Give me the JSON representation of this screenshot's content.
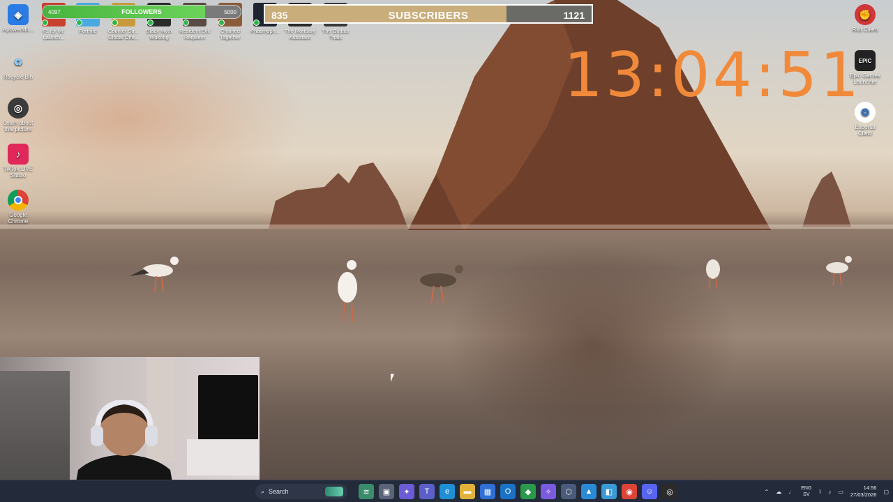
{
  "desktop": {
    "left_icons": [
      {
        "label": "ApowerMir...",
        "icon": "apowermirror-icon",
        "color": "#2a7be4"
      },
      {
        "label": "Recycle Bin",
        "icon": "recycle-bin-icon",
        "color": "#4aa3e0"
      },
      {
        "label": "Learn about this picture",
        "icon": "camera-icon",
        "color": "#3b3b3b"
      },
      {
        "label": "TikTok LIVE Studio",
        "icon": "tiktok-icon",
        "color": "#e0285a"
      },
      {
        "label": "Google Chrome",
        "icon": "chrome-icon",
        "color": "#db4437"
      }
    ],
    "right_icons": [
      {
        "label": "Riot Client",
        "icon": "riot-client-icon",
        "color": "#d13639"
      },
      {
        "label": "Epic Games Launcher",
        "icon": "epic-games-icon",
        "color": "#222222"
      },
      {
        "label": "Esportal Client",
        "icon": "esportal-icon",
        "color": "#3f7cc4"
      }
    ],
    "game_icons": [
      {
        "label": "F1 for Mr. Launch...",
        "icon": "f1-icon",
        "color": "#c8412f"
      },
      {
        "label": "Fortnite",
        "icon": "fortnite-icon",
        "color": "#4aa9de"
      },
      {
        "label": "Counter Str... Global Offe...",
        "icon": "counter-strike-icon",
        "color": "#c99a3c"
      },
      {
        "label": "Black Myth Wukong",
        "icon": "black-myth-icon",
        "color": "#2b2b2b"
      },
      {
        "label": "Resident Evil Requiem",
        "icon": "resident-evil-icon",
        "color": "#5a4a44"
      },
      {
        "label": "Chained Together",
        "icon": "chained-together-icon",
        "color": "#8b5c3a"
      },
      {
        "label": "Phasmoph...",
        "icon": "phasmophobia-icon",
        "color": "#1e2430"
      },
      {
        "label": "The Mortuary Assistant",
        "icon": "mortuary-icon",
        "color": "#2a2a2a"
      },
      {
        "label": "The Outlast Trials",
        "icon": "outlast-icon",
        "color": "#3a3a3a"
      }
    ]
  },
  "followers_goal": {
    "label": "FOLLOWERS",
    "current": "4097",
    "goal": "5000",
    "progress": 0.82
  },
  "subscribers_goal": {
    "current": "835",
    "label": "SUBSCRIBERS",
    "goal": "1121",
    "progress": 0.74
  },
  "clock": {
    "time": "13:04:51",
    "color": "#f08a3a"
  },
  "taskbar": {
    "search_placeholder": "Search",
    "apps": [
      {
        "icon": "widgets-icon",
        "color": "#3a8c6a",
        "glyph": "≋"
      },
      {
        "icon": "task-view-icon",
        "color": "#5a6478",
        "glyph": "▣"
      },
      {
        "icon": "copilot-icon",
        "color": "#6b5bd6",
        "glyph": "✦"
      },
      {
        "icon": "teams-icon",
        "color": "#5b5fc7",
        "glyph": "T"
      },
      {
        "icon": "edge-icon",
        "color": "#1f8fd6",
        "glyph": "e"
      },
      {
        "icon": "file-explorer-icon",
        "color": "#e0b23a",
        "glyph": "▬"
      },
      {
        "icon": "store-icon",
        "color": "#2f6fd6",
        "glyph": "▦"
      },
      {
        "icon": "outlook-icon",
        "color": "#1a72c7",
        "glyph": "O"
      },
      {
        "icon": "vpn-icon",
        "color": "#2a9a4a",
        "glyph": "◆"
      },
      {
        "icon": "copilot-app-icon",
        "color": "#7a5be0",
        "glyph": "✧"
      },
      {
        "icon": "app-icon",
        "color": "#4a5a7a",
        "glyph": "⬡"
      },
      {
        "icon": "photos-icon",
        "color": "#2b8ad6",
        "glyph": "▲"
      },
      {
        "icon": "screen-snip-icon",
        "color": "#3a9ad6",
        "glyph": "◧"
      },
      {
        "icon": "chrome-taskbar-icon",
        "color": "#db4437",
        "glyph": "◉"
      },
      {
        "icon": "discord-icon",
        "color": "#5865f2",
        "glyph": "☺"
      },
      {
        "icon": "obs-icon",
        "color": "#2b2b2b",
        "glyph": "◎"
      }
    ],
    "tray": {
      "lang_top": "ENG",
      "lang_bottom": "SV",
      "time": "14:56",
      "date": "27/03/2026"
    }
  }
}
